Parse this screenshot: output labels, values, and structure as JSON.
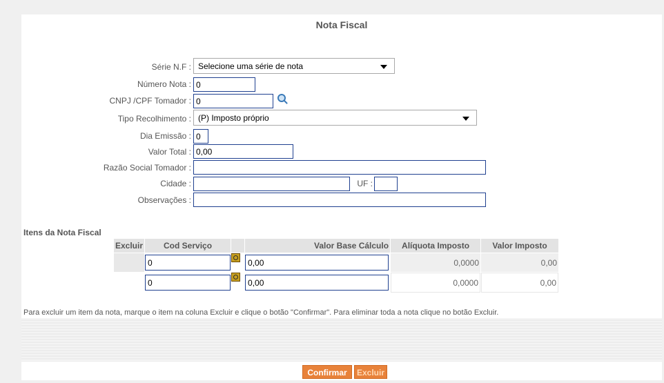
{
  "form": {
    "title": "Nota Fiscal",
    "serie_label": "Série N.F :",
    "serie_value": "Selecione uma série de nota",
    "numero_label": "Número Nota :",
    "numero_value": "0",
    "cnpj_label": "CNPJ /CPF Tomador :",
    "cnpj_value": "0",
    "tipo_label": "Tipo Recolhimento :",
    "tipo_value": "(P) Imposto próprio",
    "dia_label": "Dia Emissão :",
    "dia_value": "0",
    "valor_label": "Valor Total :",
    "valor_value": "0,00",
    "razao_label": "Razão Social Tomador :",
    "razao_value": "",
    "cidade_label": "Cidade :",
    "cidade_value": "",
    "uf_label": "UF :",
    "uf_value": "",
    "obs_label": "Observações :",
    "obs_value": ""
  },
  "itens": {
    "title": "Itens da Nota Fiscal",
    "headers": {
      "excluir": "Excluir",
      "cod": "Cod Serviço",
      "base": "Valor Base Cálculo",
      "aliquota": "Alíquota Imposto",
      "valor": "Valor Imposto"
    },
    "rows": [
      {
        "cod": "0",
        "base": "0,00",
        "aliquota": "0,0000",
        "valor": "0,00"
      },
      {
        "cod": "0",
        "base": "0,00",
        "aliquota": "0,0000",
        "valor": "0,00"
      }
    ]
  },
  "help_text": "Para excluir um item da nota, marque o item na coluna Excluir e clique o botão \"Confirmar\".  Para eliminar toda a nota clique no botão Excluir.",
  "buttons": {
    "confirmar": "Confirmar",
    "excluir": "Excluir"
  },
  "colors": {
    "accent": "#e8823a",
    "input_border": "#1e3f8f"
  },
  "icons": {
    "search": "magnifier-icon",
    "lookup": "lookup-icon"
  }
}
